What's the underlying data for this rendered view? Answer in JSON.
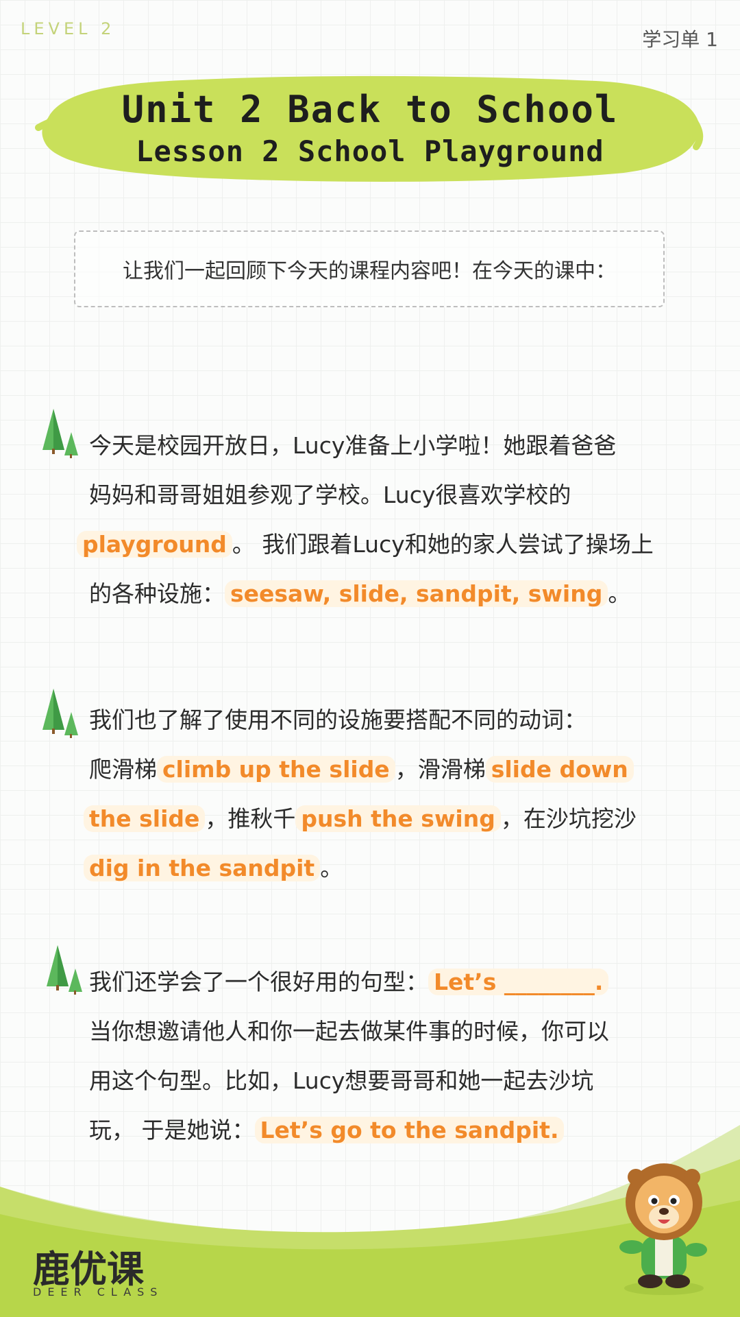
{
  "header": {
    "level": "LEVEL 2",
    "sheet_label": "学习单 1"
  },
  "title": {
    "unit": "Unit 2  Back to School",
    "lesson": "Lesson 2  School Playground"
  },
  "intro": "让我们一起回顾下今天的课程内容吧！在今天的课中：",
  "paragraph1": {
    "l1": "今天是校园开放日，Lucy准备上小学啦！她跟着爸爸",
    "l2": "妈妈和哥哥姐姐参观了学校。Lucy很喜欢学校的",
    "l3_hl": "playground",
    "l3_rest": "。 我们跟着Lucy和她的家人尝试了操场上",
    "l4_pre": "的各种设施：",
    "l4_hl": "seesaw, slide, sandpit, swing",
    "l4_end": "。"
  },
  "paragraph2": {
    "l1": "我们也了解了使用不同的设施要搭配不同的动词：",
    "l2_a": "爬滑梯",
    "l2_hl1": "climb up the slide",
    "l2_b": "，滑滑梯",
    "l2_hl2": "slide down",
    "l3_hl1": "the slide",
    "l3_a": "，推秋千",
    "l3_hl2": "push the swing",
    "l3_b": "，在沙坑挖沙",
    "l4_hl": "dig in the sandpit",
    "l4_end": "。"
  },
  "paragraph3": {
    "l1_pre": "我们还学会了一个很好用的句型：",
    "l1_hl": "Let’s ________.",
    "l2": "当你想邀请他人和你一起去做某件事的时候，你可以",
    "l3": "用这个句型。比如，Lucy想要哥哥和她一起去沙坑",
    "l4_pre": "玩， 于是她说：",
    "l4_hl": "Let’s go to the sandpit."
  },
  "footer": {
    "logo": "鹿优课",
    "logo_sub": "DEER CLASS"
  },
  "colors": {
    "banner": "#c9e05a",
    "highlight": "#f28a2a",
    "footer_green": "#b7d64a"
  },
  "icons": [
    "tree-icon",
    "lion-mascot-icon"
  ]
}
